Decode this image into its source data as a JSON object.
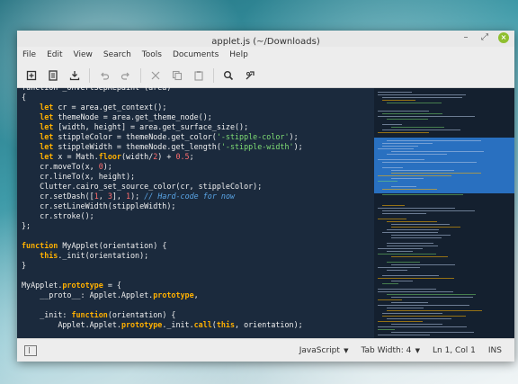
{
  "window": {
    "title": "applet.js (~/Downloads)",
    "controls": {
      "minimize": "–",
      "maximize": "⤢",
      "close": "×"
    }
  },
  "menu": [
    "File",
    "Edit",
    "View",
    "Search",
    "Tools",
    "Documents",
    "Help"
  ],
  "toolbar": {
    "icons": [
      "new-document-icon",
      "open-document-icon",
      "save-icon",
      "undo-icon",
      "redo-icon",
      "cut-icon",
      "copy-icon",
      "paste-icon",
      "search-icon",
      "replace-icon"
    ]
  },
  "code": [
    [
      {
        "t": "function _onVertSepRepaint (area)",
        "c": ""
      }
    ],
    [
      {
        "t": "{",
        "c": ""
      }
    ],
    [
      {
        "t": "    ",
        "c": ""
      },
      {
        "t": "let",
        "c": "kw"
      },
      {
        "t": " cr = area.get_context();",
        "c": ""
      }
    ],
    [
      {
        "t": "    ",
        "c": ""
      },
      {
        "t": "let",
        "c": "kw"
      },
      {
        "t": " themeNode = area.get_theme_node();",
        "c": ""
      }
    ],
    [
      {
        "t": "    ",
        "c": ""
      },
      {
        "t": "let",
        "c": "kw"
      },
      {
        "t": " [width, height] = area.get_surface_size();",
        "c": ""
      }
    ],
    [
      {
        "t": "    ",
        "c": ""
      },
      {
        "t": "let",
        "c": "kw"
      },
      {
        "t": " stippleColor = themeNode.get_color(",
        "c": ""
      },
      {
        "t": "'-stipple-color'",
        "c": "str"
      },
      {
        "t": ");",
        "c": ""
      }
    ],
    [
      {
        "t": "    ",
        "c": ""
      },
      {
        "t": "let",
        "c": "kw"
      },
      {
        "t": " stippleWidth = themeNode.get_length(",
        "c": ""
      },
      {
        "t": "'-stipple-width'",
        "c": "str"
      },
      {
        "t": ");",
        "c": ""
      }
    ],
    [
      {
        "t": "    ",
        "c": ""
      },
      {
        "t": "let",
        "c": "kw"
      },
      {
        "t": " x = Math.",
        "c": ""
      },
      {
        "t": "floor",
        "c": "kw"
      },
      {
        "t": "(width/",
        "c": ""
      },
      {
        "t": "2",
        "c": "num"
      },
      {
        "t": ") + ",
        "c": ""
      },
      {
        "t": "0.5",
        "c": "num"
      },
      {
        "t": ";",
        "c": ""
      }
    ],
    [
      {
        "t": "    cr.moveTo(x, ",
        "c": ""
      },
      {
        "t": "0",
        "c": "num"
      },
      {
        "t": ");",
        "c": ""
      }
    ],
    [
      {
        "t": "    cr.lineTo(x, height);",
        "c": ""
      }
    ],
    [
      {
        "t": "    Clutter.cairo_set_source_color(cr, stippleColor);",
        "c": ""
      }
    ],
    [
      {
        "t": "    cr.setDash([",
        "c": ""
      },
      {
        "t": "1",
        "c": "num"
      },
      {
        "t": ", ",
        "c": ""
      },
      {
        "t": "3",
        "c": "num"
      },
      {
        "t": "], ",
        "c": ""
      },
      {
        "t": "1",
        "c": "num"
      },
      {
        "t": "); ",
        "c": ""
      },
      {
        "t": "// Hard-code for now",
        "c": "cmt"
      }
    ],
    [
      {
        "t": "    cr.setLineWidth(stippleWidth);",
        "c": ""
      }
    ],
    [
      {
        "t": "    cr.stroke();",
        "c": ""
      }
    ],
    [
      {
        "t": "};",
        "c": ""
      }
    ],
    [
      {
        "t": "",
        "c": ""
      }
    ],
    [
      {
        "t": "function",
        "c": "kw"
      },
      {
        "t": " MyApplet(orientation) {",
        "c": ""
      }
    ],
    [
      {
        "t": "    ",
        "c": ""
      },
      {
        "t": "this",
        "c": "kw"
      },
      {
        "t": "._init(orientation);",
        "c": ""
      }
    ],
    [
      {
        "t": "}",
        "c": ""
      }
    ],
    [
      {
        "t": "",
        "c": ""
      }
    ],
    [
      {
        "t": "MyApplet.",
        "c": ""
      },
      {
        "t": "prototype",
        "c": "kw"
      },
      {
        "t": " = {",
        "c": ""
      }
    ],
    [
      {
        "t": "    __proto__: Applet.Applet.",
        "c": ""
      },
      {
        "t": "prototype",
        "c": "kw"
      },
      {
        "t": ",",
        "c": ""
      }
    ],
    [
      {
        "t": "",
        "c": ""
      }
    ],
    [
      {
        "t": "    _init: ",
        "c": ""
      },
      {
        "t": "function",
        "c": "kw"
      },
      {
        "t": "(orientation) {",
        "c": ""
      }
    ],
    [
      {
        "t": "        Applet.Applet.",
        "c": ""
      },
      {
        "t": "prototype",
        "c": "kw"
      },
      {
        "t": "._init.",
        "c": ""
      },
      {
        "t": "call",
        "c": "kw"
      },
      {
        "t": "(",
        "c": ""
      },
      {
        "t": "this",
        "c": "kw"
      },
      {
        "t": ", orientation);",
        "c": ""
      }
    ]
  ],
  "statusbar": {
    "language": "JavaScript",
    "tab_width": "Tab Width: 4",
    "position": "Ln 1, Col 1",
    "mode": "INS"
  },
  "colors": {
    "editor_bg": "#1b2a3d",
    "keyword": "#ffb000",
    "comment": "#5aa6e8",
    "number": "#ff6e6e",
    "string": "#7fdc74",
    "minimap_viewport": "#2d7fd9",
    "close_button": "#8fbf2f"
  }
}
